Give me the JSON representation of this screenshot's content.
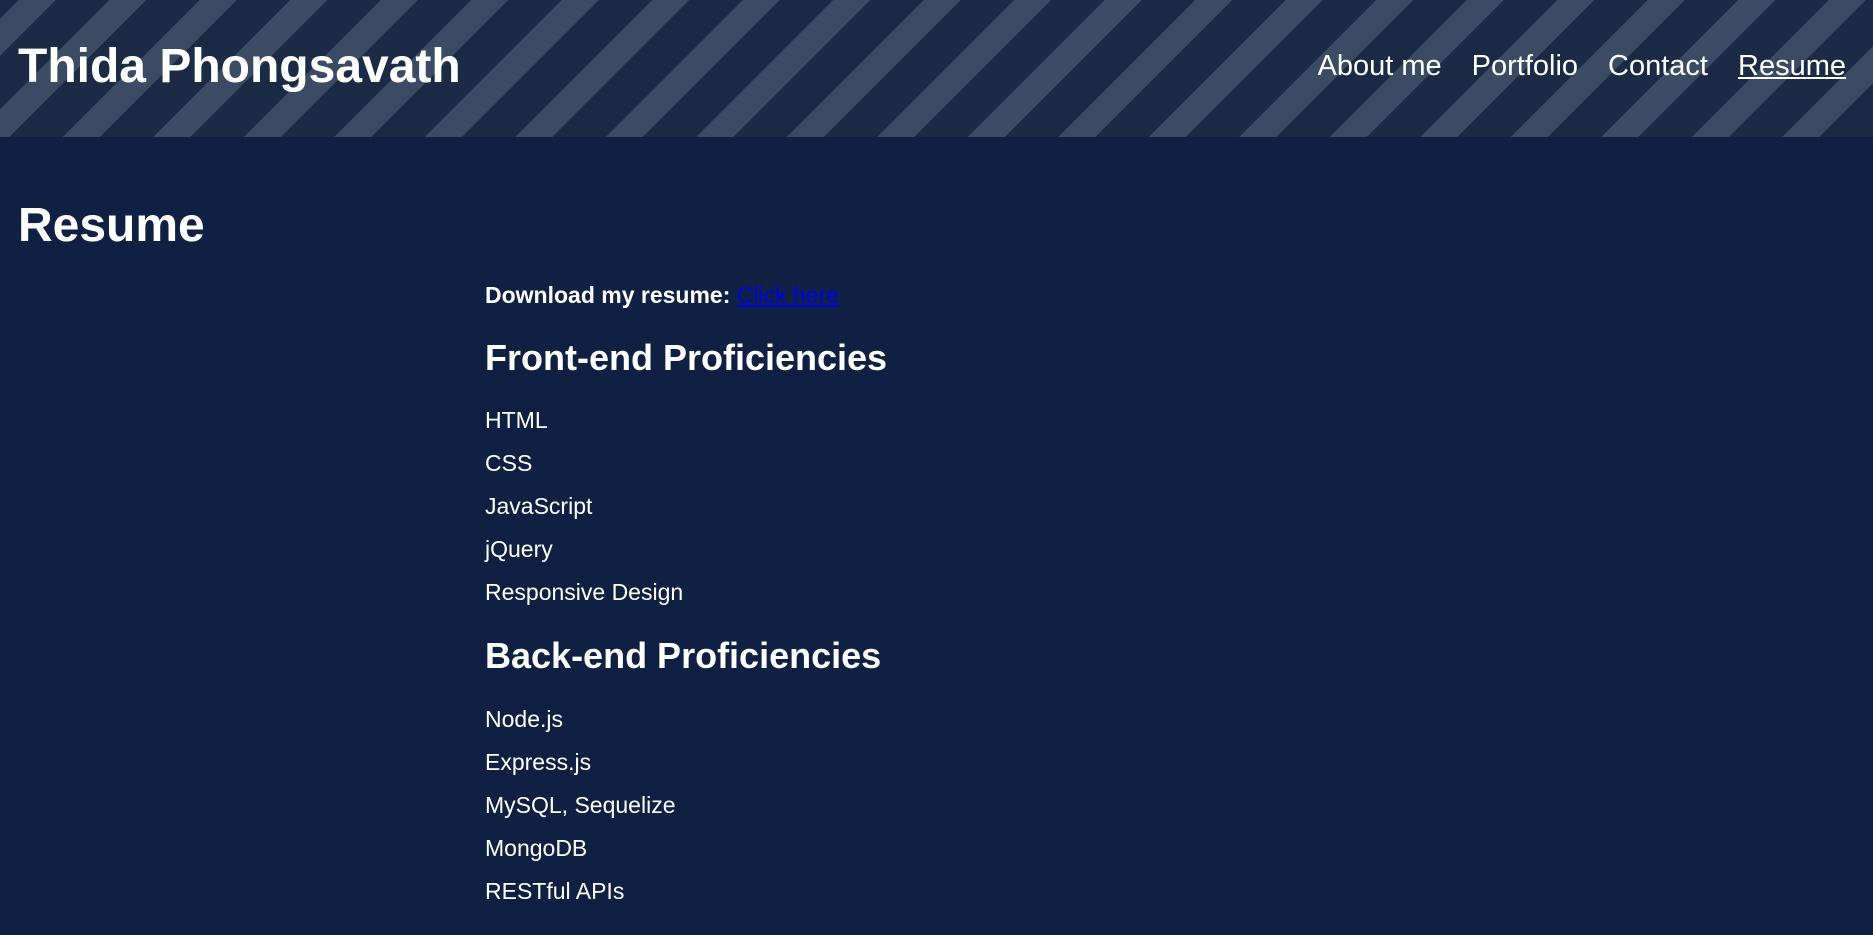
{
  "header": {
    "site_title": "Thida Phongsavath",
    "nav": [
      {
        "label": "About me",
        "active": false
      },
      {
        "label": "Portfolio",
        "active": false
      },
      {
        "label": "Contact",
        "active": false
      },
      {
        "label": "Resume",
        "active": true
      }
    ]
  },
  "main": {
    "page_heading": "Resume",
    "download_label": "Download my resume:",
    "download_link": "Click here",
    "sections": [
      {
        "heading": "Front-end Proficiencies",
        "items": [
          "HTML",
          "CSS",
          "JavaScript",
          "jQuery",
          "Responsive Design"
        ]
      },
      {
        "heading": "Back-end Proficiencies",
        "items": [
          "Node.js",
          "Express.js",
          "MySQL, Sequelize",
          "MongoDB",
          "RESTful APIs"
        ]
      }
    ]
  },
  "colors": {
    "background": "#0f2042",
    "header_stripe_dark": "#1b2a45",
    "header_stripe_light": "#3b4b64",
    "text": "#ffffff",
    "link": "#0000ee"
  }
}
